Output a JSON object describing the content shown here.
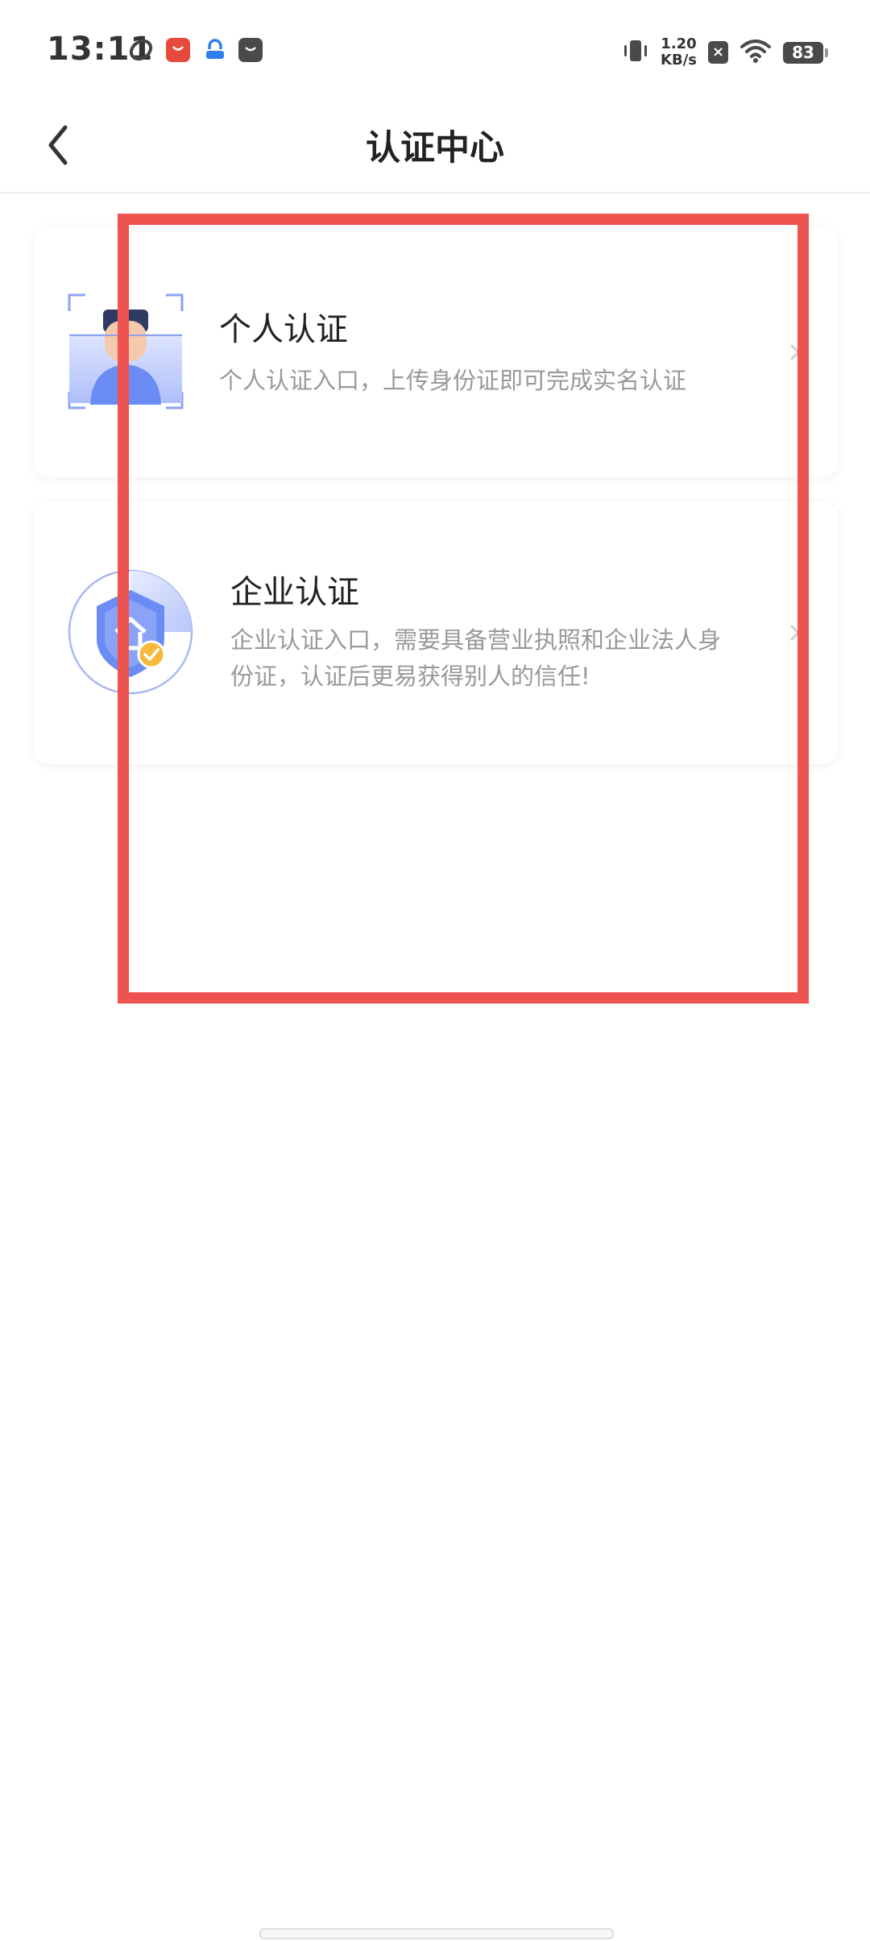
{
  "status_bar": {
    "time": "13:11",
    "net_speed_value": "1.20",
    "net_speed_unit": "KB/s",
    "battery": "83",
    "close_badge": "×",
    "icons": [
      "moon-icon",
      "shopping-icon",
      "lock-app-icon",
      "bag-icon",
      "vibrate-icon",
      "wifi-icon",
      "battery-icon"
    ]
  },
  "nav": {
    "title": "认证中心",
    "back_icon": "chevron-left-icon"
  },
  "cards": {
    "personal": {
      "title": "个人认证",
      "description": "个人认证入口，上传身份证即可完成实名认证",
      "icon": "person-id-icon"
    },
    "enterprise": {
      "title": "企业认证",
      "description_line1": "企业认证入口，需要具备营业执照和企业法人身",
      "description_line2": "份证，认证后更易获得别人的信任!",
      "icon": "enterprise-shield-icon"
    }
  },
  "colors": {
    "highlight": "#ef5350",
    "accent_blue": "#6b8cf5",
    "badge_yellow": "#f6b93b",
    "title_text": "#222222",
    "desc_text": "#999999"
  }
}
